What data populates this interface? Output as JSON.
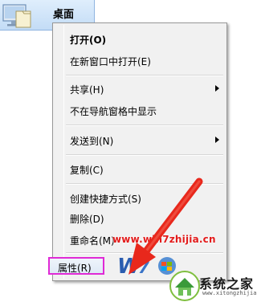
{
  "desktop": {
    "item_label": "桌面"
  },
  "context_menu": {
    "items": [
      {
        "label": "打开(O)",
        "bold": true
      },
      {
        "label": "在新窗口中打开(E)"
      },
      {
        "label": "共享(H)",
        "submenu": true
      },
      {
        "label": "不在导航窗格中显示"
      },
      {
        "label": "发送到(N)",
        "submenu": true
      },
      {
        "label": "复制(C)"
      },
      {
        "label": "创建快捷方式(S)"
      },
      {
        "label": "删除(D)"
      },
      {
        "label": "重命名(M)"
      },
      {
        "label": "属性(R)",
        "highlighted": true
      }
    ]
  },
  "watermark": {
    "url": "www.win7zhijia.cn",
    "brand": "系统之家",
    "brand_sub": "www.xitongzhijia.net"
  },
  "colors": {
    "highlight_border": "#e02ad6",
    "arrow": "#e8281c",
    "selection": "#c3dcf6"
  },
  "icons": [
    "desktop-folder-icon",
    "submenu-arrow-icon",
    "red-pointer-arrow",
    "windows-logo-icon",
    "brand-house-icon"
  ]
}
